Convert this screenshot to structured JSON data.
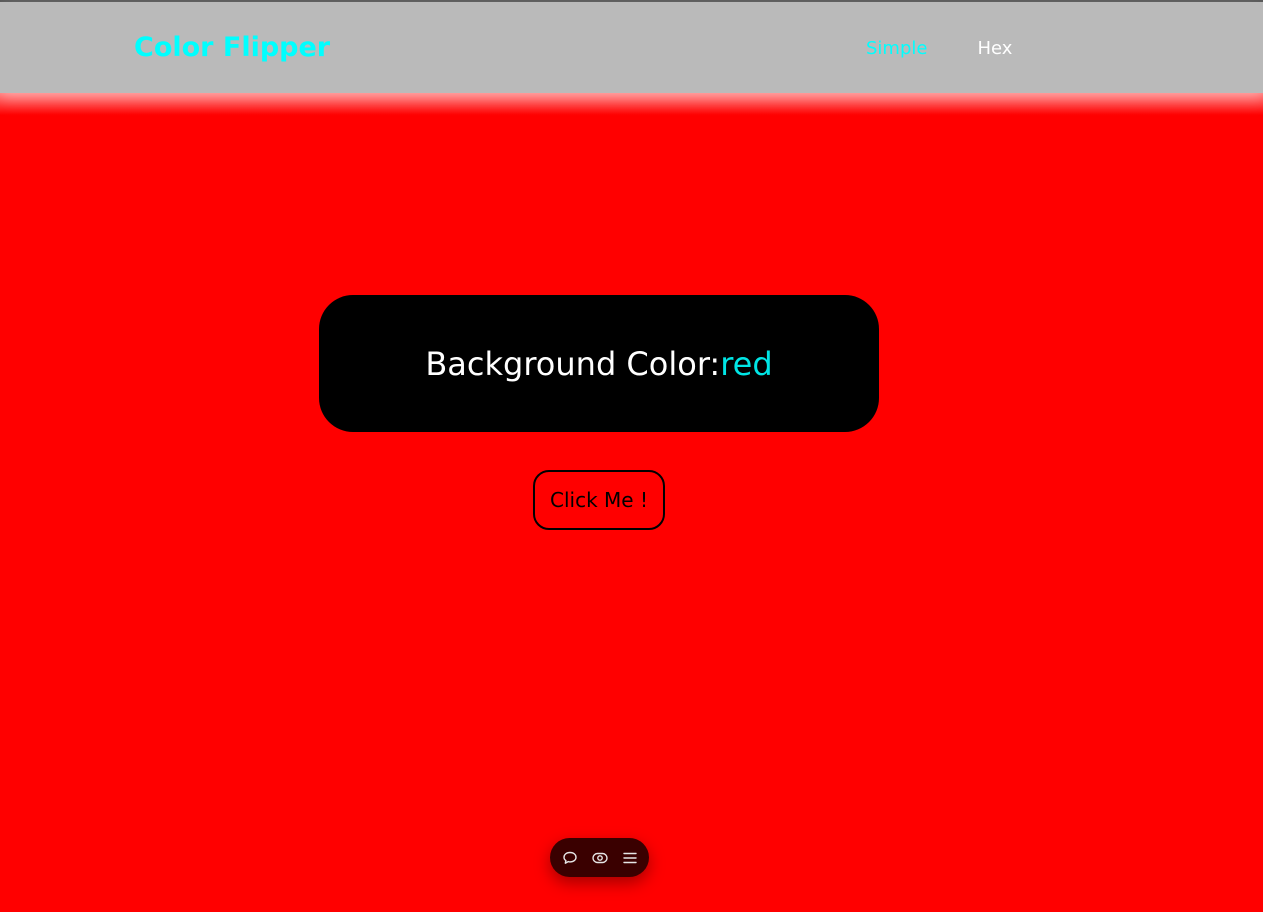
{
  "navbar": {
    "brand": "Color Flipper",
    "links": [
      {
        "label": "Simple",
        "active": true
      },
      {
        "label": "Hex",
        "active": false
      }
    ]
  },
  "main": {
    "label_prefix": "Background Color:",
    "color_value": "red",
    "button_label": "Click Me !"
  },
  "toolbar": {
    "icons": [
      "comment-icon",
      "eye-icon",
      "menu-icon"
    ]
  },
  "colors": {
    "background": "#ff0000",
    "navbar": "#bababa",
    "accent": "#00ffff",
    "card": "#000000"
  }
}
